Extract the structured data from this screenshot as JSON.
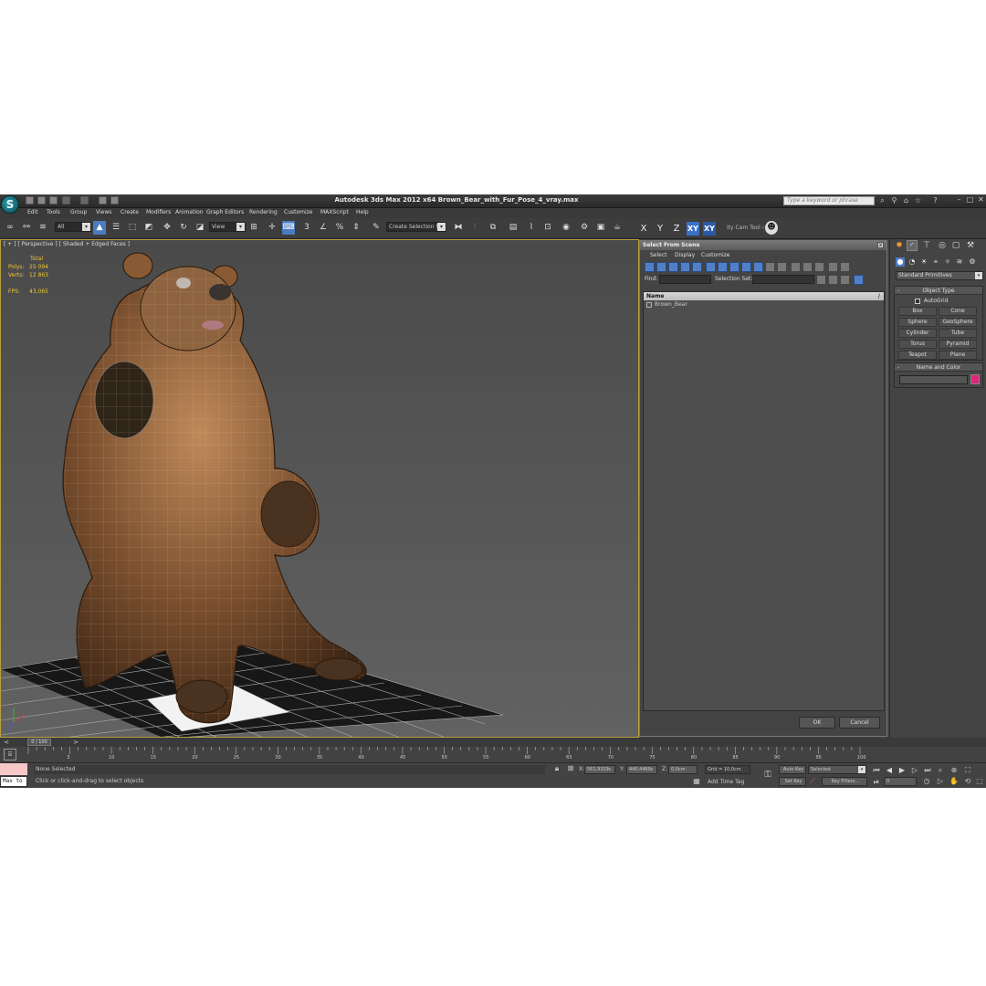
{
  "window": {
    "app_logo": "S",
    "title": "Autodesk 3ds Max  2012 x64     Brown_Bear_with_Fur_Pose_4_vray.max",
    "search_placeholder": "Type a keyword or phrase"
  },
  "menu": [
    "Edit",
    "Tools",
    "Group",
    "Views",
    "Create",
    "Modifiers",
    "Animation",
    "Graph Editors",
    "Rendering",
    "Customize",
    "MAXScript",
    "Help"
  ],
  "toolbar": {
    "filter_label": "All",
    "ref_coord_label": "View",
    "selection_set_label": "Create Selection Se",
    "axis_x": "X",
    "axis_y": "Y",
    "axis_z": "Z",
    "axis_xy": "XY",
    "axis_xy2": "XY",
    "cam_tool_label": "ity Cam Tool ‹"
  },
  "viewport": {
    "label": "[ + ] [ Perspective ] [ Shaded + Edged Faces ]",
    "stats_header": "Total",
    "polys_label": "Polys:",
    "polys_value": "25 094",
    "verts_label": "Verts:",
    "verts_value": "12 863",
    "fps_label": "FPS:",
    "fps_value": "43,065"
  },
  "select_dialog": {
    "title": "Select From Scene",
    "close_glyph": "x",
    "menu": [
      "Select",
      "Display",
      "Customize"
    ],
    "find_label": "Find:",
    "selection_set_label": "Selection Set:",
    "list_header": "Name",
    "list_sort_glyph": "/",
    "items": [
      "Brown_Bear"
    ],
    "ok_label": "OK",
    "cancel_label": "Cancel"
  },
  "command_panel": {
    "category": "Standard Primitives",
    "object_type_title": "Object Type",
    "collapse_glyph": "-",
    "autogrid_label": "AutoGrid",
    "primitives": [
      "Box",
      "Cone",
      "Sphere",
      "GeoSphere",
      "Cylinder",
      "Tube",
      "Torus",
      "Pyramid",
      "Teapot",
      "Plane"
    ],
    "name_color_title": "Name and Color",
    "color_hex": "#e0247a"
  },
  "timeline": {
    "slider_label": "0 / 100",
    "nav_prev": "<",
    "nav_next": ">",
    "ticks": [
      "5",
      "10",
      "15",
      "20",
      "25",
      "30",
      "35",
      "40",
      "45",
      "50",
      "55",
      "60",
      "65",
      "70",
      "75",
      "80",
      "85",
      "90",
      "95",
      "100"
    ]
  },
  "status": {
    "maxscript_text": "Max to",
    "selection_text": "None Selected",
    "prompt_text": "Click or click-and-drag to select objects",
    "x_label": "X:",
    "x_value": "561,9329c",
    "y_label": "Y:",
    "y_value": "440,4469c",
    "z_label": "Z:",
    "z_value": "0,0cm",
    "grid_text": "Grid = 10,0cm",
    "add_time_tag": "Add Time Tag",
    "auto_key_label": "Auto Key",
    "auto_key_value": "Selected",
    "set_key_label": "Set Key",
    "key_filters_label": "Key Filters...",
    "frame_value": "0"
  }
}
